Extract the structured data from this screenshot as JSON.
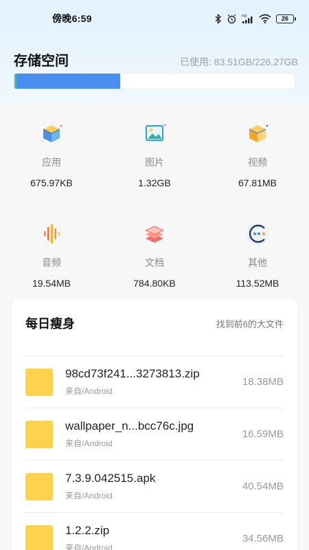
{
  "status_bar": {
    "time": "傍晚6:59",
    "battery": "26",
    "icons": [
      "bluetooth-icon",
      "alarm-icon",
      "hd-signal-icon",
      "wifi-icon",
      "battery-icon"
    ]
  },
  "storage": {
    "title": "存储空间",
    "used_text": "已使用: 83.51GB/226.27GB",
    "used_fraction": 0.369,
    "colors": {
      "fill": "#4b8ef1",
      "accent": "#3ec78a"
    }
  },
  "categories": [
    {
      "label": "应用",
      "size": "675.97KB",
      "icon": "app-box-icon"
    },
    {
      "label": "图片",
      "size": "1.32GB",
      "icon": "picture-icon"
    },
    {
      "label": "视频",
      "size": "67.81MB",
      "icon": "video-box-icon"
    },
    {
      "label": "音频",
      "size": "19.54MB",
      "icon": "audio-wave-icon"
    },
    {
      "label": "文档",
      "size": "784.80KB",
      "icon": "document-stack-icon"
    },
    {
      "label": "其他",
      "size": "113.52MB",
      "icon": "other-dots-icon"
    }
  ],
  "cleanup_card": {
    "title": "每日瘦身",
    "subtitle": "找到前6的大文件",
    "files": [
      {
        "name": "98cd73f241...3273813.zip",
        "source": "来自/Android",
        "size": "18.38MB"
      },
      {
        "name": "wallpaper_n...bcc76c.jpg",
        "source": "来自/Android",
        "size": "16.59MB"
      },
      {
        "name": "7.3.9.042515.apk",
        "source": "来自/Android",
        "size": "40.54MB"
      },
      {
        "name": "1.2.2.zip",
        "source": "来自/Android",
        "size": "34.56MB"
      }
    ]
  }
}
